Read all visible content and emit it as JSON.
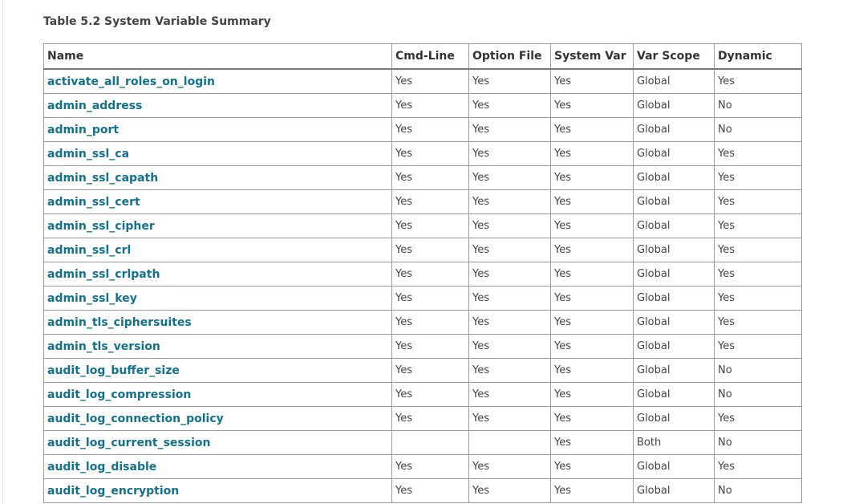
{
  "caption": "Table 5.2 System Variable Summary",
  "columns": [
    "Name",
    "Cmd-Line",
    "Option File",
    "System Var",
    "Var Scope",
    "Dynamic"
  ],
  "rows": [
    {
      "name": "activate_all_roles_on_login",
      "cmd_line": "Yes",
      "option_file": "Yes",
      "system_var": "Yes",
      "var_scope": "Global",
      "dynamic": "Yes"
    },
    {
      "name": "admin_address",
      "cmd_line": "Yes",
      "option_file": "Yes",
      "system_var": "Yes",
      "var_scope": "Global",
      "dynamic": "No"
    },
    {
      "name": "admin_port",
      "cmd_line": "Yes",
      "option_file": "Yes",
      "system_var": "Yes",
      "var_scope": "Global",
      "dynamic": "No"
    },
    {
      "name": "admin_ssl_ca",
      "cmd_line": "Yes",
      "option_file": "Yes",
      "system_var": "Yes",
      "var_scope": "Global",
      "dynamic": "Yes"
    },
    {
      "name": "admin_ssl_capath",
      "cmd_line": "Yes",
      "option_file": "Yes",
      "system_var": "Yes",
      "var_scope": "Global",
      "dynamic": "Yes"
    },
    {
      "name": "admin_ssl_cert",
      "cmd_line": "Yes",
      "option_file": "Yes",
      "system_var": "Yes",
      "var_scope": "Global",
      "dynamic": "Yes"
    },
    {
      "name": "admin_ssl_cipher",
      "cmd_line": "Yes",
      "option_file": "Yes",
      "system_var": "Yes",
      "var_scope": "Global",
      "dynamic": "Yes"
    },
    {
      "name": "admin_ssl_crl",
      "cmd_line": "Yes",
      "option_file": "Yes",
      "system_var": "Yes",
      "var_scope": "Global",
      "dynamic": "Yes"
    },
    {
      "name": "admin_ssl_crlpath",
      "cmd_line": "Yes",
      "option_file": "Yes",
      "system_var": "Yes",
      "var_scope": "Global",
      "dynamic": "Yes"
    },
    {
      "name": "admin_ssl_key",
      "cmd_line": "Yes",
      "option_file": "Yes",
      "system_var": "Yes",
      "var_scope": "Global",
      "dynamic": "Yes"
    },
    {
      "name": "admin_tls_ciphersuites",
      "cmd_line": "Yes",
      "option_file": "Yes",
      "system_var": "Yes",
      "var_scope": "Global",
      "dynamic": "Yes"
    },
    {
      "name": "admin_tls_version",
      "cmd_line": "Yes",
      "option_file": "Yes",
      "system_var": "Yes",
      "var_scope": "Global",
      "dynamic": "Yes"
    },
    {
      "name": "audit_log_buffer_size",
      "cmd_line": "Yes",
      "option_file": "Yes",
      "system_var": "Yes",
      "var_scope": "Global",
      "dynamic": "No"
    },
    {
      "name": "audit_log_compression",
      "cmd_line": "Yes",
      "option_file": "Yes",
      "system_var": "Yes",
      "var_scope": "Global",
      "dynamic": "No"
    },
    {
      "name": "audit_log_connection_policy",
      "cmd_line": "Yes",
      "option_file": "Yes",
      "system_var": "Yes",
      "var_scope": "Global",
      "dynamic": "Yes"
    },
    {
      "name": "audit_log_current_session",
      "cmd_line": "",
      "option_file": "",
      "system_var": "Yes",
      "var_scope": "Both",
      "dynamic": "No"
    },
    {
      "name": "audit_log_disable",
      "cmd_line": "Yes",
      "option_file": "Yes",
      "system_var": "Yes",
      "var_scope": "Global",
      "dynamic": "Yes"
    },
    {
      "name": "audit_log_encryption",
      "cmd_line": "Yes",
      "option_file": "Yes",
      "system_var": "Yes",
      "var_scope": "Global",
      "dynamic": "No"
    }
  ]
}
